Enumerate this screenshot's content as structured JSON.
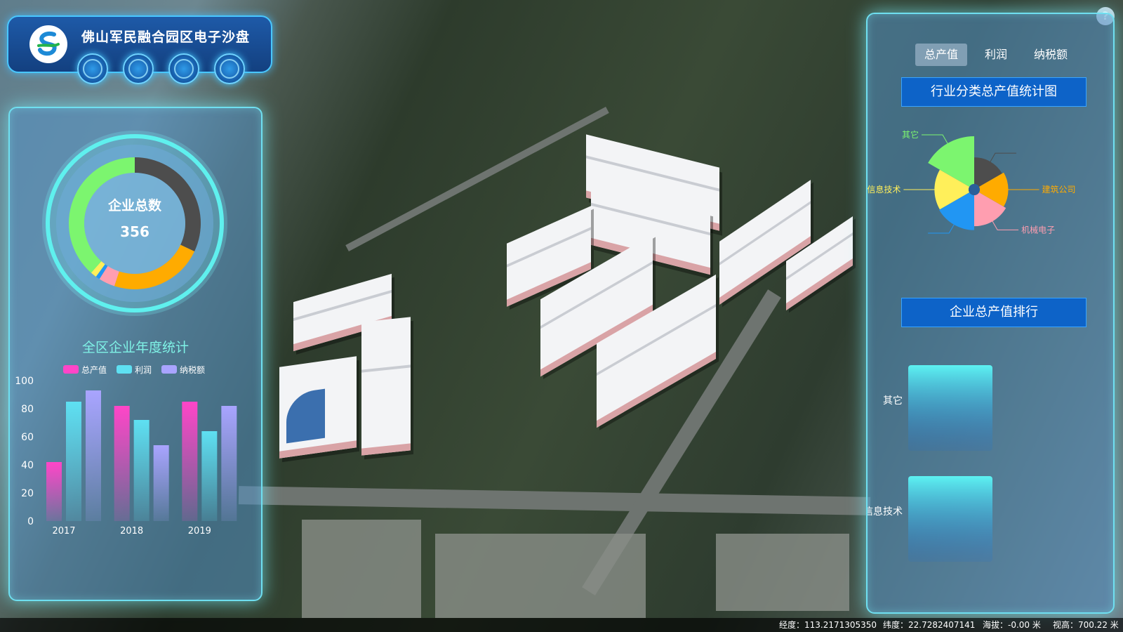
{
  "app": {
    "title": "佛山军民融合园区电子沙盘"
  },
  "colors": {
    "accent_cyan": "#6fdff0",
    "title_bg": "#1e5aa8",
    "section_bg": "#0d63c8"
  },
  "left_panel": {
    "donut": {
      "label": "企业总数",
      "value": "356",
      "segments": [
        {
          "color": "#4d4d4d",
          "value": 32
        },
        {
          "color": "#ffab00",
          "value": 23
        },
        {
          "color": "#ff9eb0",
          "value": 4
        },
        {
          "color": "#2196f3",
          "value": 1
        },
        {
          "color": "#ffef5a",
          "value": 1.5
        },
        {
          "color": "#7cf56f",
          "value": 38.5
        }
      ]
    },
    "bar_chart_title": "全区企业年度统计"
  },
  "right_panel": {
    "tabs": [
      {
        "label": "总产值",
        "active": true
      },
      {
        "label": "利润",
        "active": false
      },
      {
        "label": "纳税额",
        "active": false
      }
    ],
    "pie_title": "行业分类总产值统计图",
    "rank_title": "企业总产值排行"
  },
  "status_bar": {
    "longitude": "经度：113.2171305350",
    "latitude": "纬度：22.7282407141",
    "altitude": "海拔：-0.00 米",
    "view_height": "视高：700.22 米"
  },
  "help_icon": "?",
  "chart_data": [
    {
      "type": "bar",
      "title": "全区企业年度统计",
      "categories": [
        "2017",
        "2018",
        "2019"
      ],
      "ylim": [
        0,
        100
      ],
      "yticks": [
        0,
        20,
        40,
        60,
        80,
        100
      ],
      "series": [
        {
          "name": "总产值",
          "color": "#ff45c8",
          "values": [
            42,
            82,
            85
          ]
        },
        {
          "name": "利润",
          "color": "#5ee0f2",
          "values": [
            85,
            72,
            64
          ]
        },
        {
          "name": "纳税额",
          "color": "#a9a4ff",
          "values": [
            93,
            54,
            82
          ]
        }
      ],
      "legend": "top"
    },
    {
      "type": "pie",
      "title": "行业分类总产值统计图",
      "subtype": "rose",
      "slices": [
        {
          "name": "其它",
          "value": 90,
          "color": "#7cf56f",
          "label_color": "#7cf56f",
          "label_side": "left"
        },
        {
          "name": "",
          "value": 28,
          "color": "#4d4d4d",
          "label_color": "#4d4d4d",
          "label_side": "right"
        },
        {
          "name": "建筑公司",
          "value": 32,
          "color": "#ffab00",
          "label_color": "#ffab00",
          "label_side": "right"
        },
        {
          "name": "机械电子",
          "value": 38,
          "color": "#ff9eb0",
          "label_color": "#ff9eb0",
          "label_side": "right"
        },
        {
          "name": "",
          "value": 48,
          "color": "#2196f3",
          "label_color": "#2196f3",
          "label_side": "left"
        },
        {
          "name": "信息技术",
          "value": 46,
          "color": "#ffef5a",
          "label_color": "#ffef5a",
          "label_side": "left"
        }
      ]
    },
    {
      "type": "bar",
      "orientation": "horizontal-rank",
      "title": "企业总产值排行",
      "categories": [
        "其它",
        "信息技术"
      ],
      "values": [
        100,
        100
      ]
    }
  ]
}
